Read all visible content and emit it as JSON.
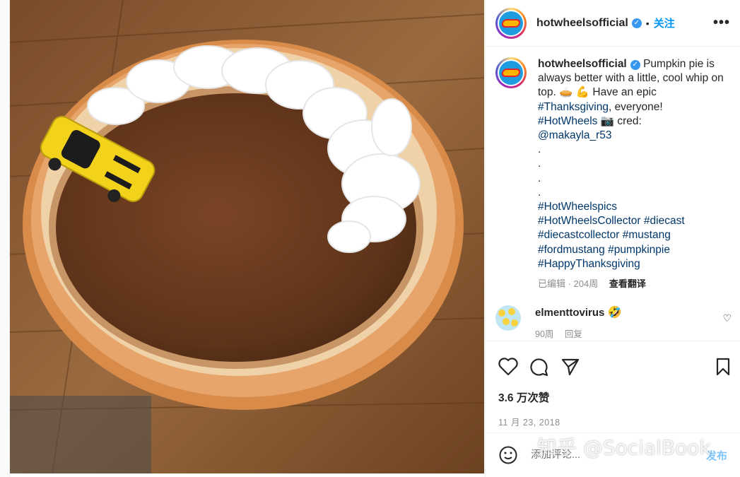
{
  "header": {
    "username": "hotwheelsofficial",
    "verified_mark": "✓",
    "separator": "•",
    "follow_label": "关注",
    "more_label": "•••"
  },
  "caption": {
    "username": "hotwheelsofficial",
    "verified_mark": "✓",
    "text_1": "Pumpkin pie is always better with a little, cool whip on top.",
    "emoji_1": "🥧 💪",
    "text_2": "Have an epic",
    "tag_1": "#Thanksgiving",
    "text_3": ", everyone!",
    "tag_2": "#HotWheels",
    "emoji_2": "📷",
    "text_4": "cred:",
    "mention": "@makayla_r53",
    "dots": ".",
    "tags": [
      "#HotWheelspics",
      "#HotWheelsCollector",
      "#diecast",
      "#diecastcollector",
      "#mustang",
      "#fordmustang",
      "#pumpkinpie",
      "#HappyThanksgiving"
    ],
    "meta_edited": "已编辑 · 204周",
    "meta_translate": "查看翻译"
  },
  "comment": {
    "username": "elmenttovirus",
    "emoji": "🤣",
    "age": "90周",
    "reply_label": "回复",
    "heart": "♡"
  },
  "actions": {
    "likes": "3.6 万次赞",
    "date": "11 月 23, 2018"
  },
  "add_comment": {
    "placeholder": "添加评论...",
    "post_label": "发布"
  },
  "watermark": "知乎 @SocialBook",
  "colors": {
    "link": "#00376b",
    "follow": "#0095f6",
    "pie_dish": "#d98b4a",
    "pie_filling": "#6b3a1c",
    "car": "#f2d21b",
    "table": "#8a5a34"
  },
  "photo": {
    "subjects": [
      "pumpkin pie",
      "whipped cream",
      "yellow toy car",
      "wooden table"
    ]
  }
}
